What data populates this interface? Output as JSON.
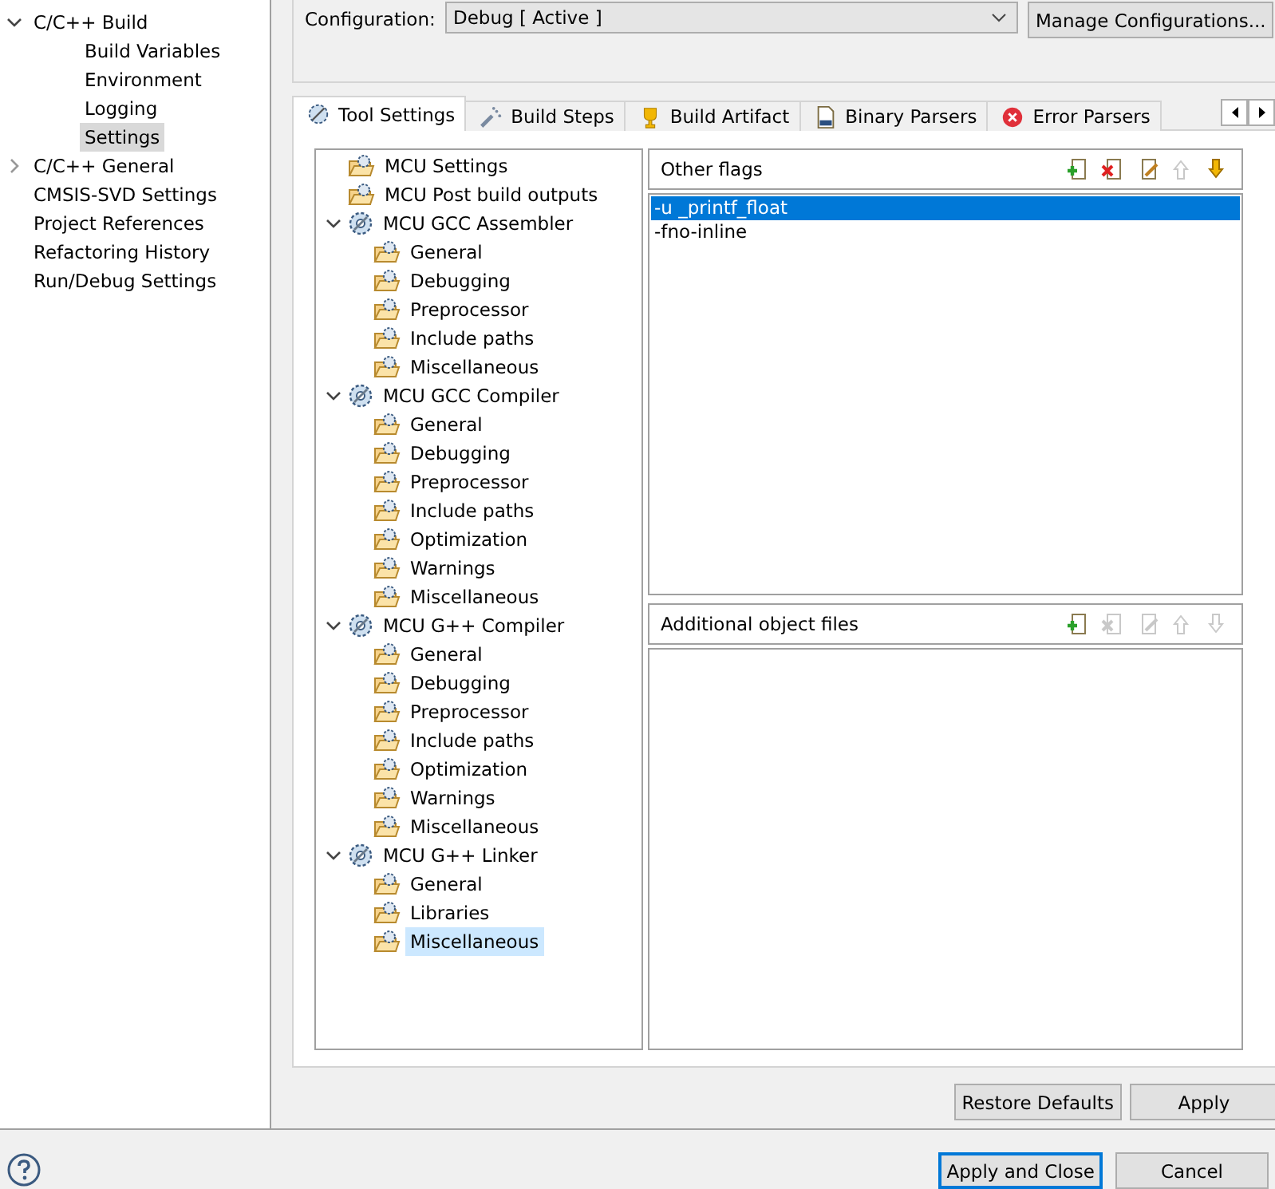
{
  "sidebar": {
    "items": [
      {
        "label": "C/C++ Build",
        "expanded": true,
        "selected": false,
        "children": [
          {
            "label": "Build Variables",
            "selected": false
          },
          {
            "label": "Environment",
            "selected": false
          },
          {
            "label": "Logging",
            "selected": false
          },
          {
            "label": "Settings",
            "selected": true
          }
        ]
      },
      {
        "label": "C/C++ General",
        "expanded": false,
        "selected": false
      },
      {
        "label": "CMSIS-SVD Settings",
        "selected": false
      },
      {
        "label": "Project References",
        "selected": false
      },
      {
        "label": "Refactoring History",
        "selected": false
      },
      {
        "label": "Run/Debug Settings",
        "selected": false
      }
    ]
  },
  "configuration": {
    "label": "Configuration:",
    "value": "Debug  [ Active ]",
    "manage_button": "Manage Configurations..."
  },
  "tabs": [
    {
      "label": "Tool Settings",
      "selected": true
    },
    {
      "label": "Build Steps",
      "selected": false
    },
    {
      "label": "Build Artifact",
      "selected": false
    },
    {
      "label": "Binary Parsers",
      "selected": false
    },
    {
      "label": "Error Parsers",
      "selected": false
    }
  ],
  "tool_tree": [
    {
      "label": "MCU Settings",
      "kind": "page",
      "selected": false
    },
    {
      "label": "MCU Post build outputs",
      "kind": "page",
      "selected": false
    },
    {
      "label": "MCU GCC Assembler",
      "kind": "tool",
      "expanded": true,
      "selected": false,
      "children": [
        {
          "label": "General",
          "kind": "page",
          "selected": false
        },
        {
          "label": "Debugging",
          "kind": "page",
          "selected": false
        },
        {
          "label": "Preprocessor",
          "kind": "page",
          "selected": false
        },
        {
          "label": "Include paths",
          "kind": "page",
          "selected": false
        },
        {
          "label": "Miscellaneous",
          "kind": "page",
          "selected": false
        }
      ]
    },
    {
      "label": "MCU GCC Compiler",
      "kind": "tool",
      "expanded": true,
      "selected": false,
      "children": [
        {
          "label": "General",
          "kind": "page",
          "selected": false
        },
        {
          "label": "Debugging",
          "kind": "page",
          "selected": false
        },
        {
          "label": "Preprocessor",
          "kind": "page",
          "selected": false
        },
        {
          "label": "Include paths",
          "kind": "page",
          "selected": false
        },
        {
          "label": "Optimization",
          "kind": "page",
          "selected": false
        },
        {
          "label": "Warnings",
          "kind": "page",
          "selected": false
        },
        {
          "label": "Miscellaneous",
          "kind": "page",
          "selected": false
        }
      ]
    },
    {
      "label": "MCU G++ Compiler",
      "kind": "tool",
      "expanded": true,
      "selected": false,
      "children": [
        {
          "label": "General",
          "kind": "page",
          "selected": false
        },
        {
          "label": "Debugging",
          "kind": "page",
          "selected": false
        },
        {
          "label": "Preprocessor",
          "kind": "page",
          "selected": false
        },
        {
          "label": "Include paths",
          "kind": "page",
          "selected": false
        },
        {
          "label": "Optimization",
          "kind": "page",
          "selected": false
        },
        {
          "label": "Warnings",
          "kind": "page",
          "selected": false
        },
        {
          "label": "Miscellaneous",
          "kind": "page",
          "selected": false
        }
      ]
    },
    {
      "label": "MCU G++ Linker",
      "kind": "tool",
      "expanded": true,
      "selected": false,
      "children": [
        {
          "label": "General",
          "kind": "page",
          "selected": false
        },
        {
          "label": "Libraries",
          "kind": "page",
          "selected": false
        },
        {
          "label": "Miscellaneous",
          "kind": "page",
          "selected": true
        }
      ]
    }
  ],
  "option_lists": [
    {
      "title": "Other flags",
      "tools": [
        {
          "kind": "add",
          "disabled": false
        },
        {
          "kind": "delete",
          "disabled": false
        },
        {
          "kind": "edit",
          "disabled": false
        },
        {
          "kind": "up",
          "disabled": true
        },
        {
          "kind": "down",
          "disabled": false
        }
      ],
      "items": [
        {
          "text": "-u _printf_float",
          "selected": true
        },
        {
          "text": "-fno-inline",
          "selected": false
        }
      ]
    },
    {
      "title": "Additional object files",
      "tools": [
        {
          "kind": "add",
          "disabled": false
        },
        {
          "kind": "delete",
          "disabled": true
        },
        {
          "kind": "edit",
          "disabled": true
        },
        {
          "kind": "up",
          "disabled": true
        },
        {
          "kind": "down",
          "disabled": true
        }
      ]
    }
  ],
  "page_buttons": [
    "Restore Defaults",
    "Apply"
  ],
  "dialog_buttons": [
    {
      "label": "Apply and Close",
      "default": true
    },
    {
      "label": "Cancel",
      "default": false
    }
  ]
}
